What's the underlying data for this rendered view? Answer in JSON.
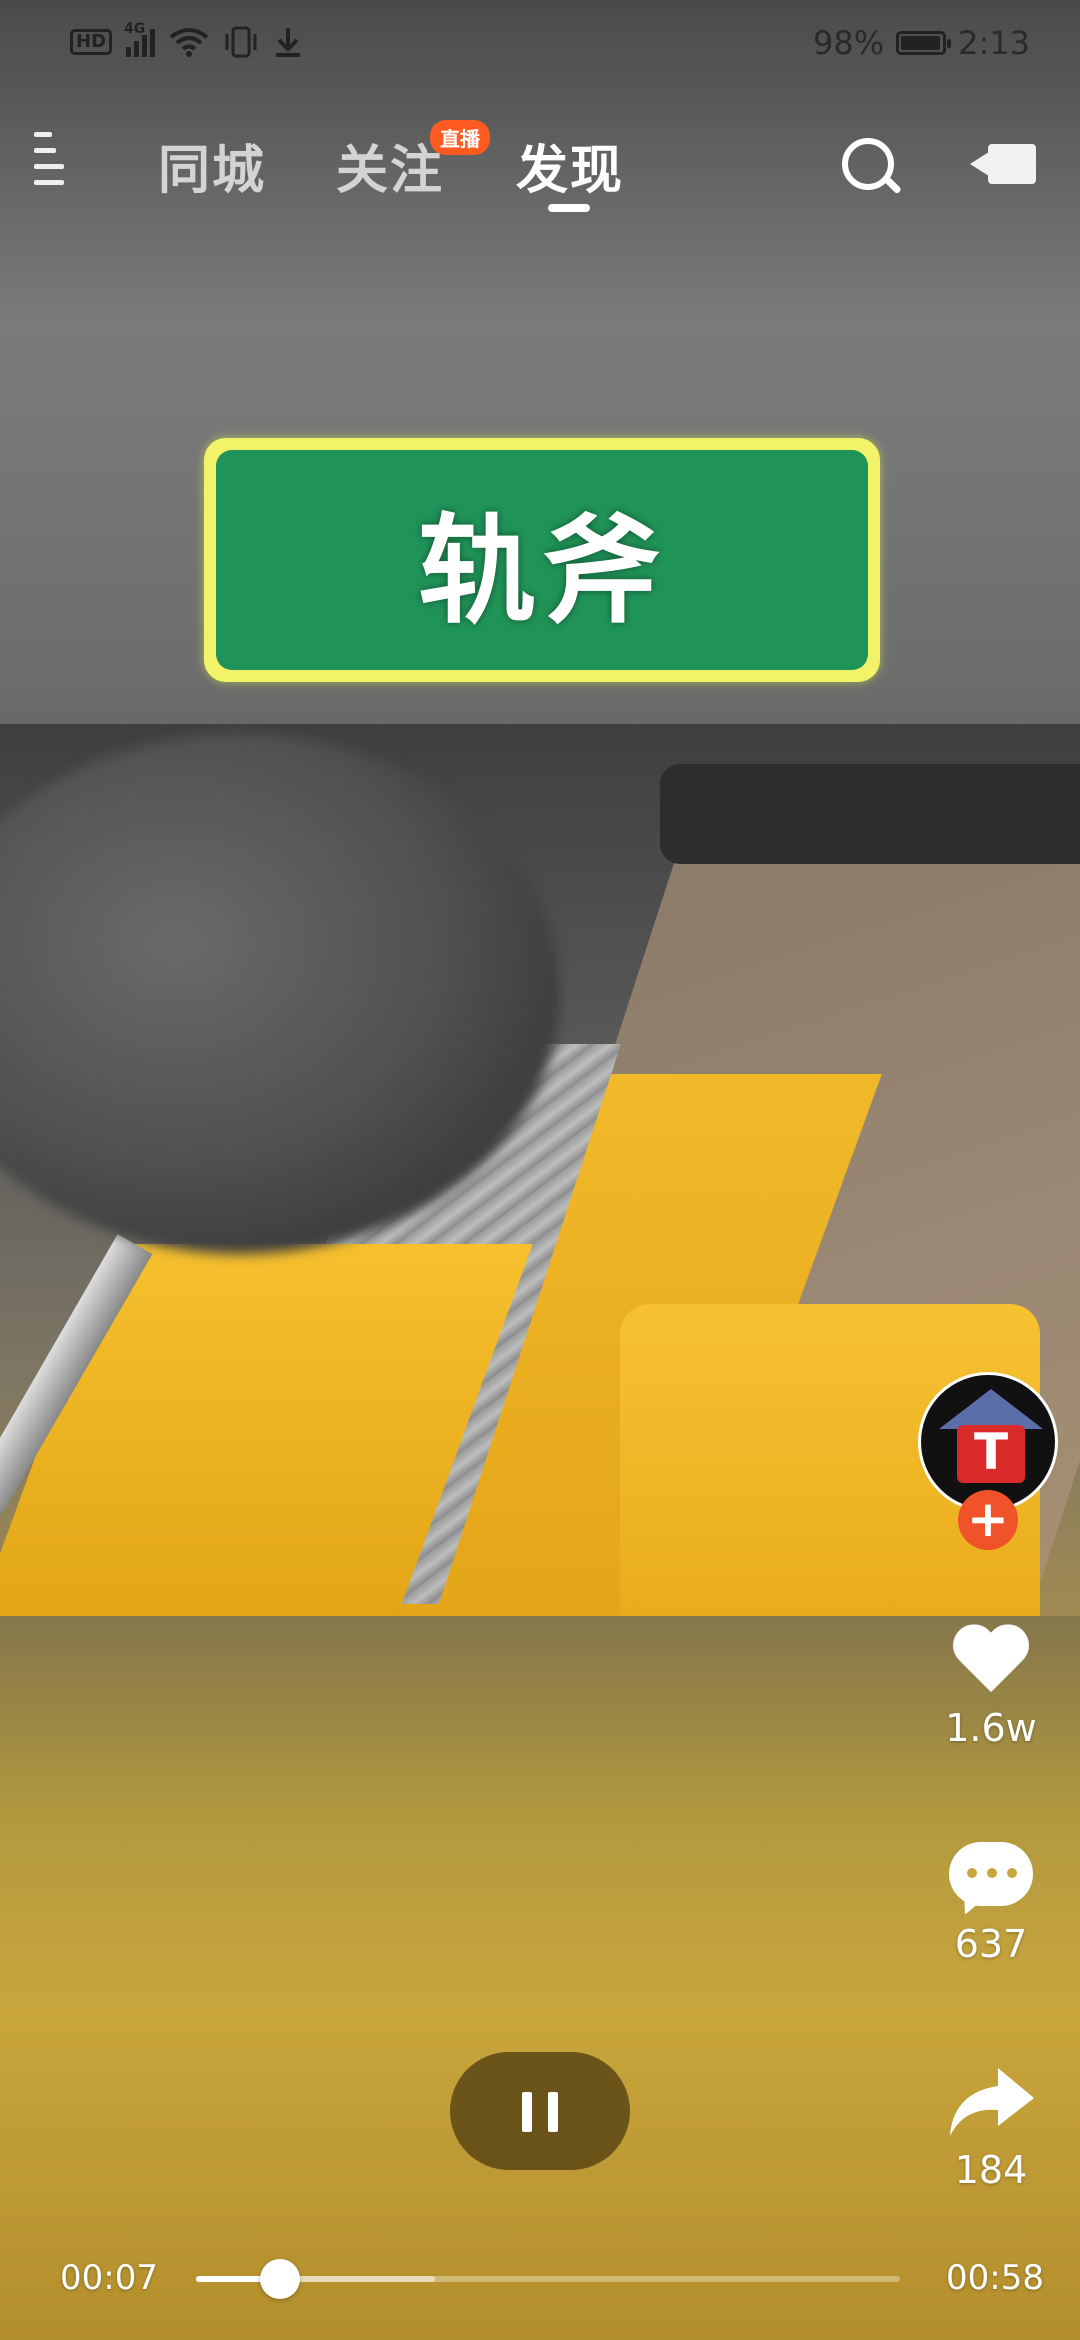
{
  "status_bar": {
    "hd": "HD",
    "network": "4G",
    "battery_percent": "98%",
    "battery_level": 0.98,
    "time": "2:13",
    "icons": [
      "hd-icon",
      "signal-icon",
      "wifi-icon",
      "vibrate-icon",
      "download-icon",
      "battery-icon"
    ]
  },
  "nav": {
    "tabs": [
      {
        "label": "同城"
      },
      {
        "label": "关注",
        "badge": "直播"
      },
      {
        "label": "发现"
      }
    ],
    "active_tab": "发现"
  },
  "video": {
    "title_text": "轨斧",
    "colors": {
      "sign_border": "#f3f36a",
      "sign_fill": "#209458"
    }
  },
  "actions": {
    "likes": "1.6w",
    "comments": "637",
    "shares": "184"
  },
  "player": {
    "current_time": "00:07",
    "duration": "00:58",
    "progress": 0.12,
    "buffered": 0.34
  },
  "colors": {
    "accent": "#ff5a1f",
    "follow": "#f0522a"
  }
}
